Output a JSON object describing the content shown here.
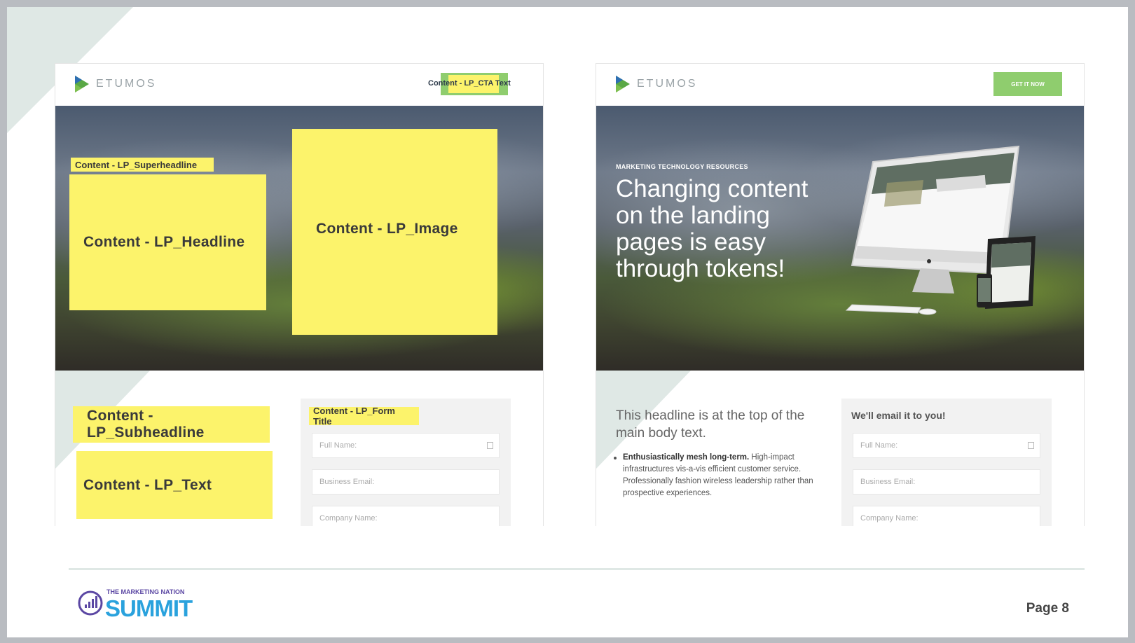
{
  "left_panel": {
    "logo_text": "ETUMOS",
    "cta_label": "Content - LP_CTA Text",
    "superheadline": "Content - LP_Superheadline",
    "headline": "Content - LP_Headline",
    "image": "Content - LP_Image",
    "subheadline": "Content - LP_Subheadline",
    "text": "Content - LP_Text",
    "form_title": "Content - LP_Form Title",
    "fields": [
      "Full Name:",
      "Business Email:",
      "Company Name:"
    ]
  },
  "right_panel": {
    "logo_text": "ETUMOS",
    "cta_label": "GET IT NOW",
    "superheadline": "MARKETING TECHNOLOGY RESOURCES",
    "headline": "Changing content on the landing pages is easy through tokens!",
    "subheadline": "This headline is at the top of the main body text.",
    "bullet_bold": "Enthusiastically mesh long-term.",
    "bullet_text": "High-impact infrastructures vis-a-vis efficient customer service. Professionally fashion wireless leadership rather than prospective experiences.",
    "form_title": "We'll email it to you!",
    "fields": [
      "Full Name:",
      "Business Email:",
      "Company Name:"
    ]
  },
  "footer": {
    "logo_small": "THE MARKETING NATION",
    "logo_big": "SUMMIT",
    "page_label": "Page 8"
  },
  "colors": {
    "accent_yellow": "#fcf36b",
    "cta_green": "#8fcd6e",
    "summit_blue": "#2aa2dd",
    "tint": "#dfe8e5"
  }
}
